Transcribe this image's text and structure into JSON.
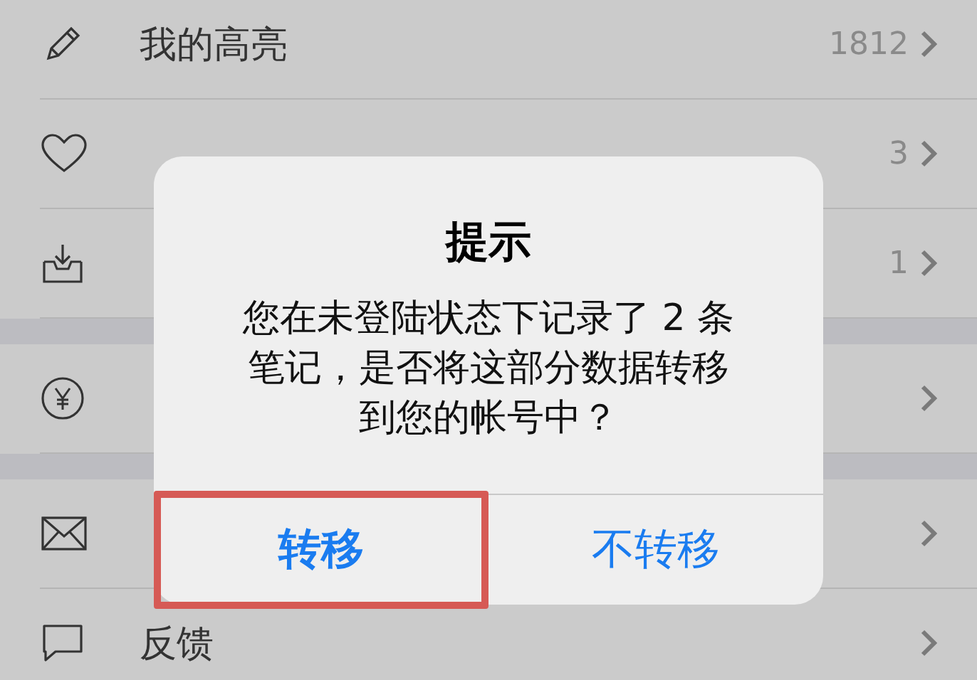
{
  "list": {
    "sections": [
      {
        "rows": [
          {
            "kind": "pencil",
            "label": "我的高亮",
            "count": "1812"
          },
          {
            "kind": "heart",
            "count": "3"
          },
          {
            "kind": "inbox",
            "count": "1"
          }
        ]
      },
      {
        "rows": [
          {
            "kind": "yen"
          }
        ]
      },
      {
        "rows": [
          {
            "kind": "mail"
          },
          {
            "kind": "chat",
            "label": "反馈"
          }
        ]
      }
    ]
  },
  "dialog": {
    "title": "提示",
    "message_lines": [
      "您在未登陆状态下记录了 2 条",
      "笔记，是否将这部分数据转移",
      "到您的帐号中？"
    ],
    "buttons": [
      {
        "label": "转移",
        "bold": true,
        "highlighted": true
      },
      {
        "label": "不转移",
        "bold": false,
        "highlighted": false
      }
    ]
  }
}
